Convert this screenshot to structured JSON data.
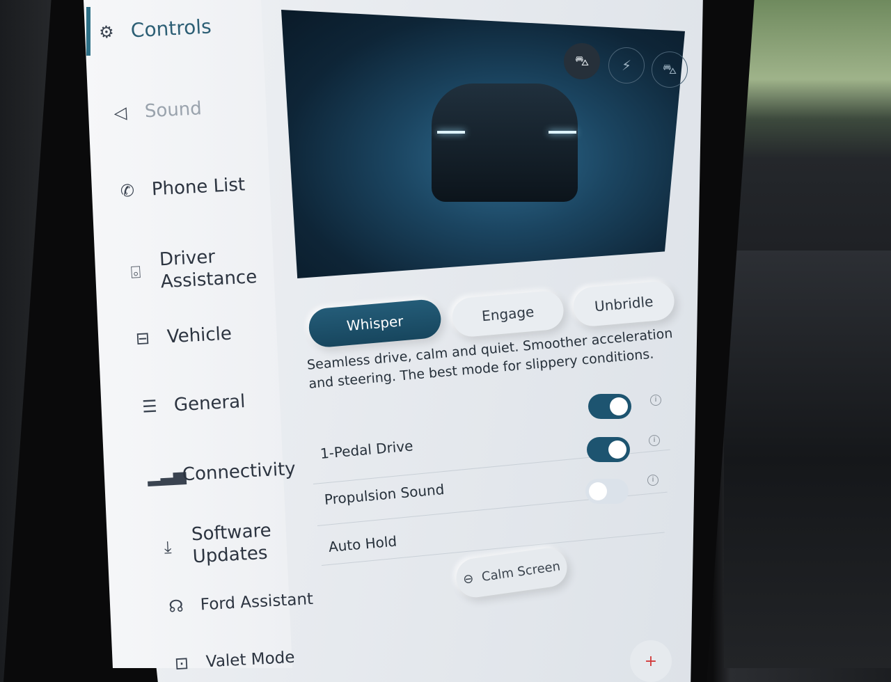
{
  "sidebar": {
    "items": [
      {
        "label": "Controls",
        "icon": "controls-icon",
        "active": true
      },
      {
        "label": "Sound",
        "icon": "speaker-icon"
      },
      {
        "label": "Phone List",
        "icon": "phone-icon"
      },
      {
        "label": "Driver Assistance",
        "icon": "driver-assist-icon"
      },
      {
        "label": "Vehicle",
        "icon": "vehicle-icon"
      },
      {
        "label": "General",
        "icon": "sliders-icon"
      },
      {
        "label": "Connectivity",
        "icon": "signal-icon"
      },
      {
        "label": "Software Updates",
        "icon": "download-icon"
      },
      {
        "label": "Ford Assistant",
        "icon": "assistant-icon"
      },
      {
        "label": "Valet Mode",
        "icon": "valet-icon"
      }
    ]
  },
  "hero": {
    "buttons": [
      {
        "icon": "car-hood-icon",
        "selected": true
      },
      {
        "icon": "charge-port-icon"
      },
      {
        "icon": "car-trunk-icon"
      }
    ]
  },
  "modes": {
    "options": [
      "Whisper",
      "Engage",
      "Unbridle"
    ],
    "selected": "Whisper"
  },
  "description": "Seamless drive, calm and quiet. Smoother acceleration and steering. The best mode for slippery conditions.",
  "settings": [
    {
      "label": "1-Pedal Drive",
      "on": true
    },
    {
      "label": "Propulsion Sound",
      "on": true
    },
    {
      "label": "Auto Hold",
      "on": false
    }
  ],
  "calm_screen": {
    "label": "Calm Screen",
    "icon": "calm-screen-icon"
  },
  "fab": {
    "icon": "plus-icon",
    "color": "#d23a3a"
  },
  "colors": {
    "accent": "#1d5470",
    "sidebar_active": "#2d5f75"
  }
}
